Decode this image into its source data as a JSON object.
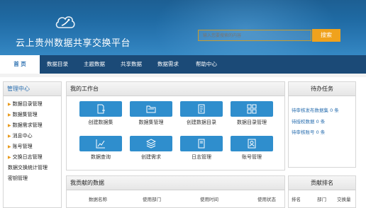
{
  "header": {
    "site_title": "云上贵州数据共享交换平台",
    "logo": "cloud-swoosh-icon",
    "search": {
      "placeholder": "输入您要搜索的内容",
      "button_label": "搜索"
    }
  },
  "nav": {
    "items": [
      {
        "label": "首 页",
        "active": true
      },
      {
        "label": "数据目录"
      },
      {
        "label": "主题数据"
      },
      {
        "label": "共享数据"
      },
      {
        "label": "数据需求"
      },
      {
        "label": "帮助中心"
      }
    ]
  },
  "sidebar": {
    "title": "管理中心",
    "items": [
      {
        "label": "数据目录管理",
        "arrow": true
      },
      {
        "label": "数据集管理",
        "arrow": true
      },
      {
        "label": "数据需求管理",
        "arrow": true
      },
      {
        "label": "消息中心",
        "arrow": true
      },
      {
        "label": "账号管理",
        "arrow": true
      },
      {
        "label": "交换日志管理",
        "arrow": true
      },
      {
        "label": "数据交换统计管理",
        "arrow": false
      },
      {
        "label": "密钥管理",
        "arrow": false
      }
    ]
  },
  "workbench": {
    "title": "我的工作台",
    "tiles": [
      {
        "label": "创建数据集",
        "icon": "create-dataset-icon"
      },
      {
        "label": "数据集管理",
        "icon": "folder-icon"
      },
      {
        "label": "创建数据目录",
        "icon": "document-list-icon"
      },
      {
        "label": "数据目录管理",
        "icon": "grid-icon"
      },
      {
        "label": "数据查询",
        "icon": "chart-query-icon"
      },
      {
        "label": "创建需求",
        "icon": "layers-icon"
      },
      {
        "label": "日志管理",
        "icon": "log-document-icon"
      },
      {
        "label": "账号管理",
        "icon": "account-icon"
      }
    ]
  },
  "contrib": {
    "title": "我贡献的数据",
    "columns": [
      "数据名称",
      "使用部门",
      "使用时间",
      "使用状态"
    ]
  },
  "todo": {
    "title": "待办任务",
    "items": [
      "待审核发布数据集 0 条",
      "待授权数据 0 条",
      "待审核账号 0 条"
    ]
  },
  "rank": {
    "title": "贡献排名",
    "columns": [
      "排名",
      "部门",
      "交换量"
    ]
  },
  "colors": {
    "header_blue": "#1f6aa3",
    "nav_dark": "#1b4a77",
    "tile_blue": "#2f8ecd",
    "accent_orange": "#f0a21c",
    "link_blue": "#2a6fb0"
  }
}
